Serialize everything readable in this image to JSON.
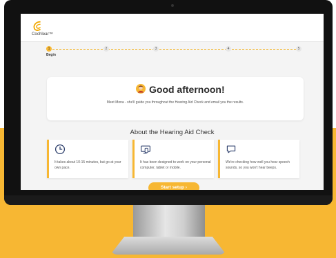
{
  "brand": {
    "name": "Cochlear™",
    "accent": "#f7b733"
  },
  "progress": {
    "steps": [
      "1",
      "2",
      "3",
      "4",
      "5"
    ],
    "current_caption": "Begin"
  },
  "greeting": {
    "title": "Good afternoon!",
    "subtitle": "Meet Mona - she'll guide you throughout the Hearing Aid Check and email you the results."
  },
  "about": {
    "heading": "About the Hearing Aid Check",
    "cards": [
      {
        "icon": "clock-icon",
        "text": "It takes about 10-15 minutes, but go at your own pace."
      },
      {
        "icon": "device-icon",
        "text": "It has been designed to work on your personal computer, tablet or mobile."
      },
      {
        "icon": "speech-bubble-icon",
        "text": "We're checking how well you hear speech sounds, so you won't hear beeps."
      }
    ]
  },
  "actions": {
    "start_label": "Start setup ›"
  }
}
